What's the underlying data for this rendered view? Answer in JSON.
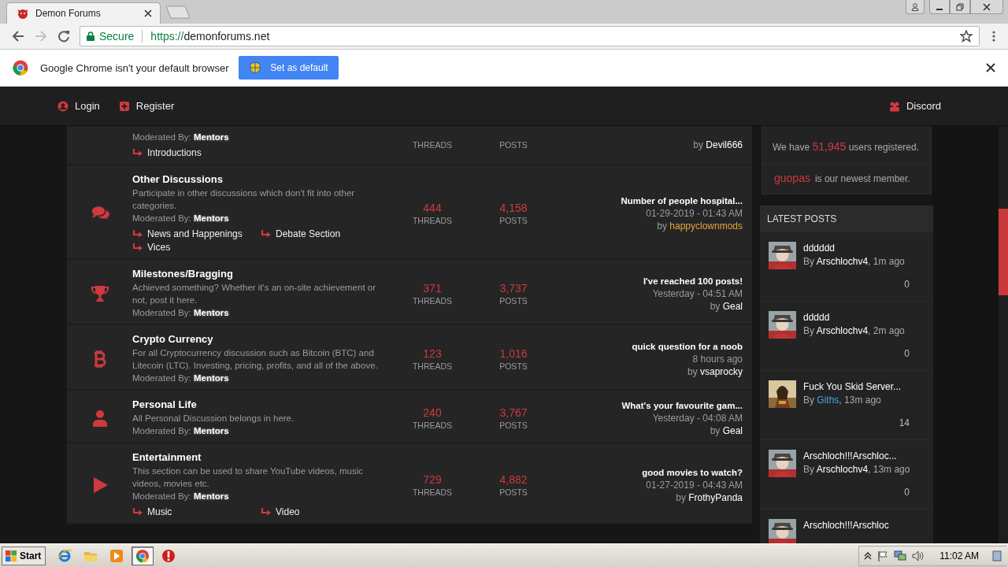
{
  "browser": {
    "tab_title": "Demon Forums",
    "secure_label": "Secure",
    "url_scheme": "https://",
    "url_host": "demonforums.net"
  },
  "infobar": {
    "message": "Google Chrome isn't your default browser",
    "button": "Set as default"
  },
  "site_nav": {
    "left": [
      {
        "label": "Login",
        "kind": "user"
      },
      {
        "label": "Register",
        "kind": "plus"
      }
    ],
    "right": [
      {
        "label": "Discord",
        "kind": "group"
      }
    ]
  },
  "forums": [
    {
      "moderated": "Moderated By: **Mentors**",
      "subforums": [
        "Introductions"
      ],
      "threads_label": "THREADS",
      "posts_label": "POSTS",
      "last_post": {
        "by": "by",
        "author": "Devil666",
        "color": "#ffffff"
      }
    },
    {
      "kind": "chat",
      "title": "Other Discussions",
      "description": "Participate in other discussions which don't fit into other categories.",
      "moderated": "Moderated By: **Mentors**",
      "subforums": [
        "News and Happenings",
        "Debate Section",
        "Vices"
      ],
      "threads": "444",
      "threads_label": "THREADS",
      "posts": "4,158",
      "posts_label": "POSTS",
      "last_post": {
        "title": "Number of people hospital...",
        "date": "01-29-2019 - 01:43 AM",
        "by": "by",
        "author": "happyclownmods",
        "color": "#e8a33d"
      }
    },
    {
      "kind": "trophy",
      "title": "Milestones/Bragging",
      "description": "Achieved something? Whether it's an on-site achievement or not, post it here.",
      "moderated": "Moderated By: **Mentors**",
      "threads": "371",
      "threads_label": "THREADS",
      "posts": "3,737",
      "posts_label": "POSTS",
      "last_post": {
        "title": "I've reached 100 posts!",
        "date": "Yesterday - 04:51 AM",
        "by": "by",
        "author": "Geal",
        "color": "#ffffff"
      }
    },
    {
      "kind": "coin",
      "title": "Crypto Currency",
      "description": "For all Cryptocurrency discussion such as Bitcoin (BTC) and Litecoin (LTC). Investing, pricing, profits, and all of the above.",
      "moderated": "Moderated By: **Mentors**",
      "threads": "123",
      "threads_label": "THREADS",
      "posts": "1,016",
      "posts_label": "POSTS",
      "last_post": {
        "title": "quick question for a noob",
        "date": "8 hours ago",
        "by": "by",
        "author": "vsaprocky",
        "color": "#ffffff"
      }
    },
    {
      "kind": "person",
      "title": "Personal Life",
      "description": "All Personal Discussion belongs in here.",
      "moderated": "Moderated By: **Mentors**",
      "threads": "240",
      "threads_label": "THREADS",
      "posts": "3,767",
      "posts_label": "POSTS",
      "last_post": {
        "title": "What's your favourite gam...",
        "date": "Yesterday - 04:08 AM",
        "by": "by",
        "author": "Geal",
        "color": "#ffffff"
      }
    },
    {
      "kind": "play",
      "title": "Entertainment",
      "description": "This section can be used to share YouTube videos, music videos, movies etc.",
      "moderated": "Moderated By: **Mentors**",
      "subforums": [
        "Music",
        "Video"
      ],
      "threads": "729",
      "threads_label": "THREADS",
      "posts": "4,882",
      "posts_label": "POSTS",
      "last_post": {
        "title": "good movies to watch?",
        "date": "01-27-2019 - 04:43 AM",
        "by": "by",
        "author": "FrothyPanda",
        "color": "#ffffff"
      }
    }
  ],
  "stats": {
    "prefix": "We have",
    "count": "51,945",
    "suffix": "users registered.",
    "newest": "guopas",
    "newest_suffix": "is our newest member."
  },
  "latest_posts": {
    "title": "LATEST POSTS",
    "items": [
      {
        "title": "dddddd",
        "by": "By",
        "author": "Arschlochv4",
        "color": "#ffffff",
        "ago": ", 1m ago",
        "replies": "0"
      },
      {
        "title": "ddddd",
        "by": "By",
        "author": "Arschlochv4",
        "color": "#ffffff",
        "ago": ", 2m ago",
        "replies": "0"
      },
      {
        "title": "Fuck You Skid Server...",
        "by": "By",
        "author": "Giths",
        "color": "#4aa3df",
        "ago": ", 13m ago",
        "replies": "14"
      },
      {
        "title": "Arschloch!!!Arschloc...",
        "by": "By",
        "author": "Arschlochv4",
        "color": "#ffffff",
        "ago": ", 13m ago",
        "replies": "0"
      },
      {
        "title": "Arschloch!!!Arschloc"
      }
    ]
  },
  "taskbar": {
    "start": "Start",
    "apps": [
      {
        "kind": "browser",
        "selected": false
      },
      {
        "kind": "folder",
        "selected": false
      },
      {
        "kind": "media",
        "selected": false
      },
      {
        "kind": "chrome",
        "selected": true
      },
      {
        "kind": "alert",
        "selected": false
      }
    ],
    "clock": "11:02 AM"
  }
}
